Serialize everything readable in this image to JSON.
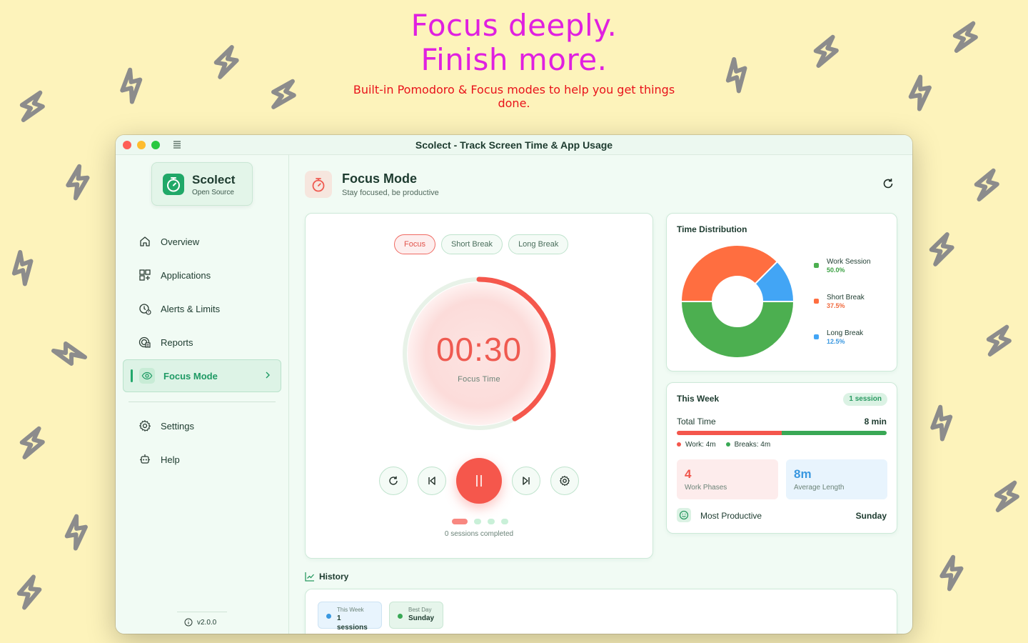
{
  "promo": {
    "headline_line1": "Focus deeply.",
    "headline_line2": "Finish more.",
    "subtext": "Built-in Pomodoro & Focus modes to help you get things done.",
    "headline_color": "#e020e0",
    "subtext_color": "#e8121a"
  },
  "window": {
    "title": "Scolect - Track Screen Time & App Usage"
  },
  "sidebar": {
    "brand_name": "Scolect",
    "brand_sub": "Open Source",
    "items": [
      {
        "label": "Overview",
        "icon": "home-icon"
      },
      {
        "label": "Applications",
        "icon": "grid-icon"
      },
      {
        "label": "Alerts & Limits",
        "icon": "clock-alert-icon"
      },
      {
        "label": "Reports",
        "icon": "reports-icon"
      },
      {
        "label": "Focus Mode",
        "icon": "eye-icon",
        "active": true
      },
      {
        "label": "Settings",
        "icon": "gear-icon"
      },
      {
        "label": "Help",
        "icon": "help-icon"
      }
    ],
    "version": "v2.0.0"
  },
  "page": {
    "title": "Focus Mode",
    "subtitle": "Stay focused, be productive"
  },
  "timer": {
    "modes": [
      "Focus",
      "Short Break",
      "Long Break"
    ],
    "active_mode": "Focus",
    "time": "00:30",
    "label": "Focus Time",
    "progress_fraction": 0.42,
    "sessions_text": "0 sessions completed",
    "accent_color": "#f5574c"
  },
  "distribution": {
    "title": "Time Distribution",
    "segments": [
      {
        "name": "Work Session",
        "pct": "50.0%",
        "value": 50.0,
        "color": "#4caf50"
      },
      {
        "name": "Short Break",
        "pct": "37.5%",
        "value": 37.5,
        "color": "#ff6e40"
      },
      {
        "name": "Long Break",
        "pct": "12.5%",
        "value": 12.5,
        "color": "#42a5f5"
      }
    ]
  },
  "week": {
    "title": "This Week",
    "badge": "1 session",
    "total_label": "Total Time",
    "total_value": "8 min",
    "work_fraction": 0.5,
    "work_text": "Work: 4m",
    "breaks_text": "Breaks: 4m",
    "phases_value": "4",
    "phases_label": "Work Phases",
    "avg_value": "8m",
    "avg_label": "Average Length",
    "productive_label": "Most Productive",
    "productive_value": "Sunday"
  },
  "history": {
    "title": "History",
    "chips": [
      {
        "key": "This Week",
        "value": "1 sessions",
        "color": "#3a98e0"
      },
      {
        "key": "Best Day",
        "value": "Sunday",
        "color": "#39a855"
      }
    ]
  }
}
